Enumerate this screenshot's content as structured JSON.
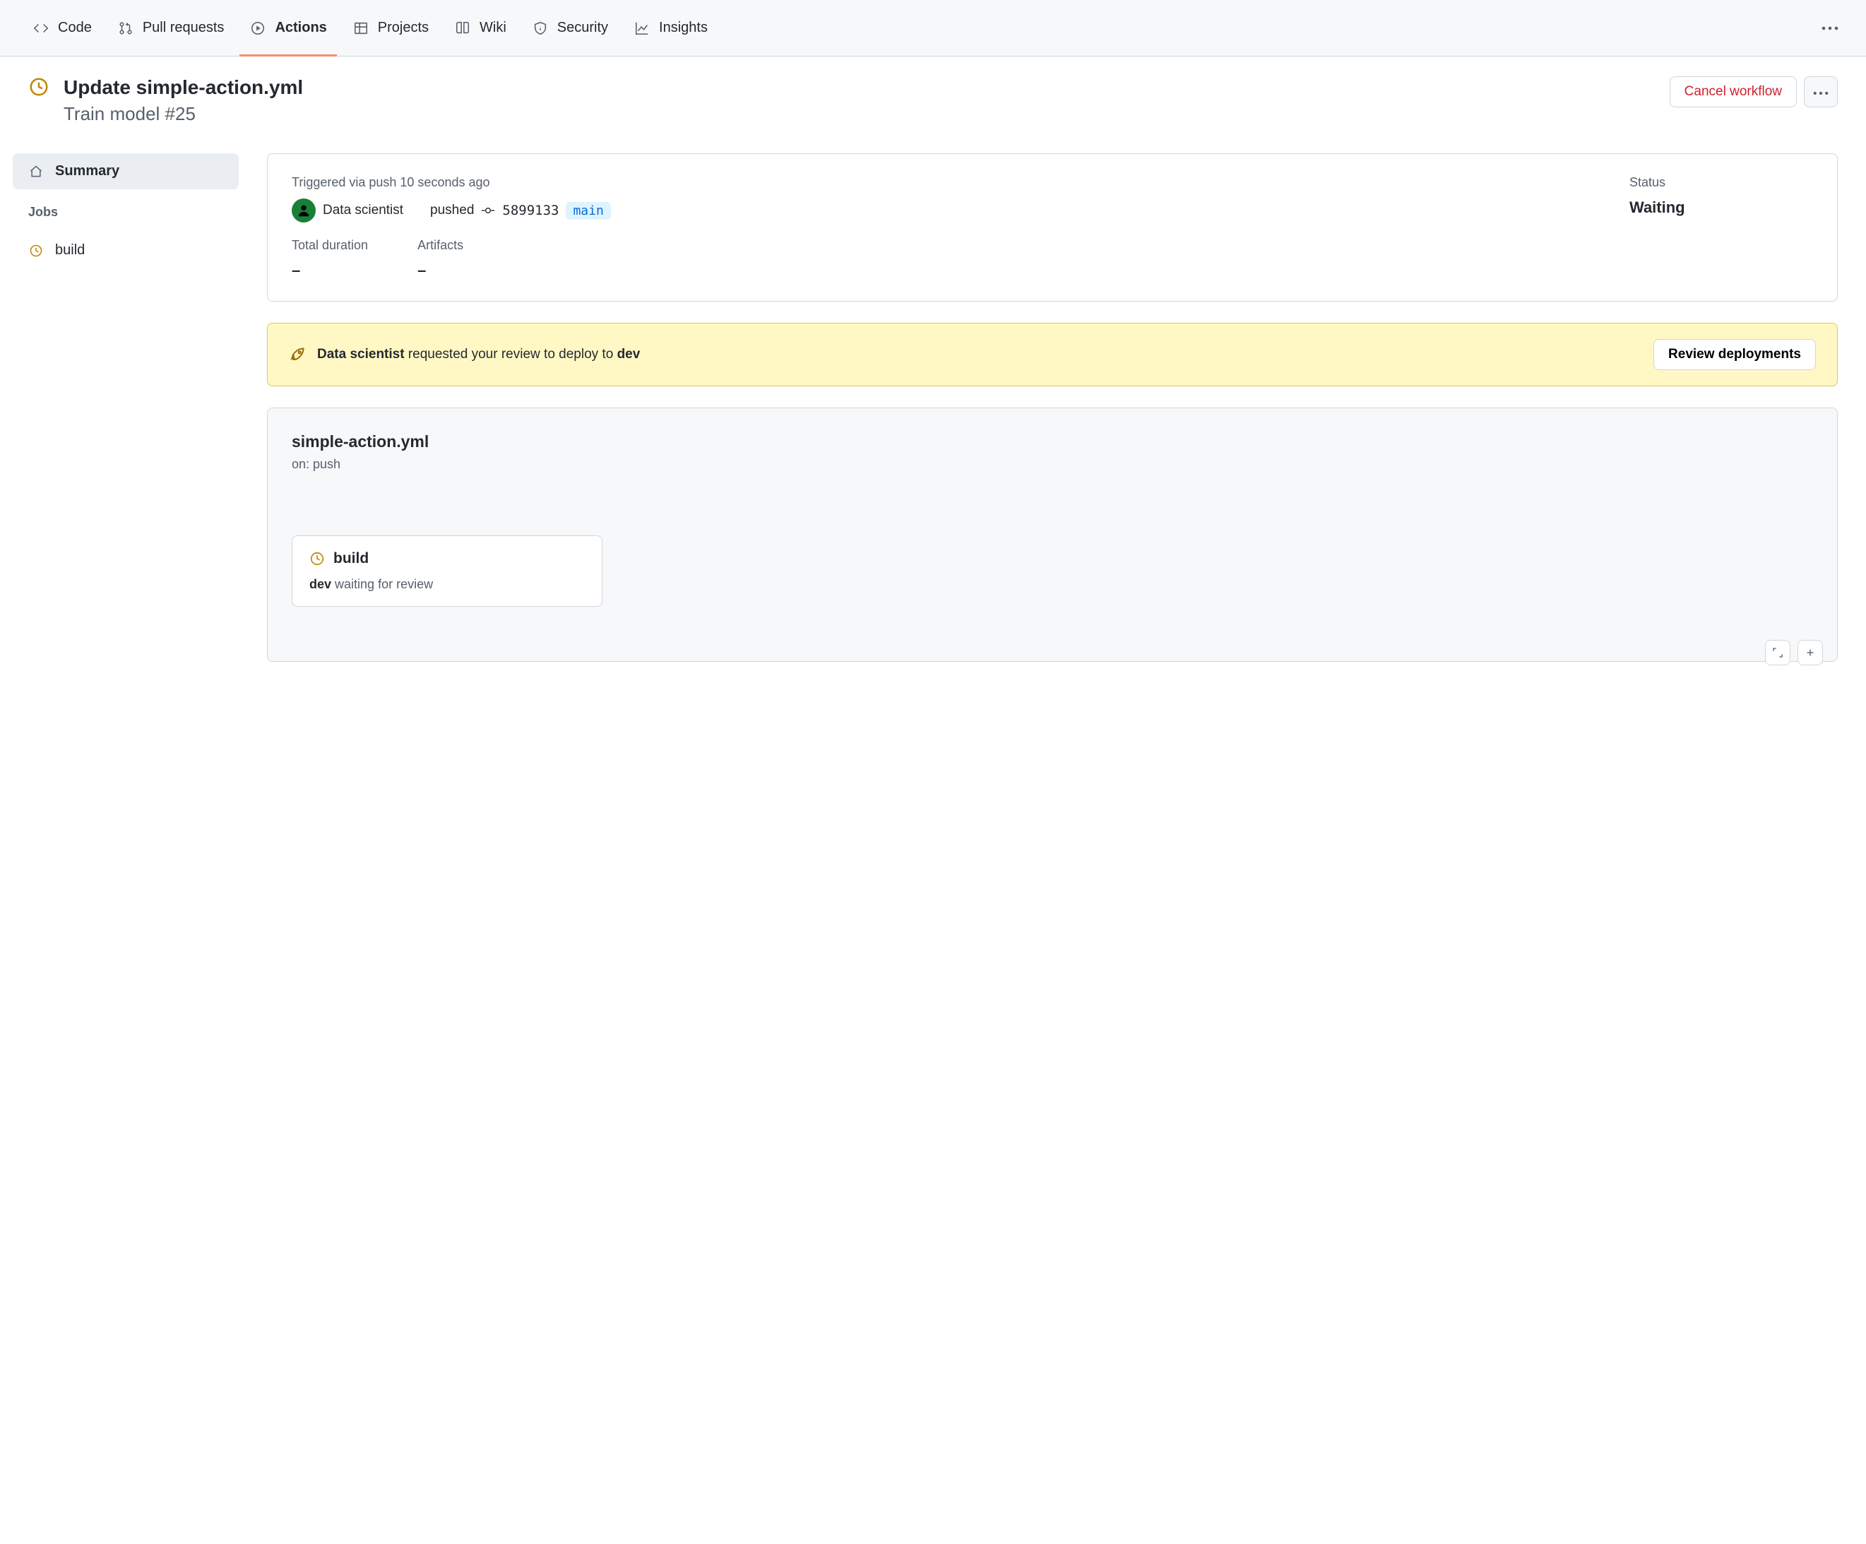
{
  "nav": {
    "code": "Code",
    "pulls": "Pull requests",
    "actions": "Actions",
    "projects": "Projects",
    "wiki": "Wiki",
    "security": "Security",
    "insights": "Insights"
  },
  "header": {
    "title": "Update simple-action.yml",
    "subtitle": "Train model #25",
    "cancel": "Cancel workflow"
  },
  "sidebar": {
    "summary": "Summary",
    "jobs_heading": "Jobs",
    "build": "build"
  },
  "summary": {
    "triggered_line": "Triggered via push 10 seconds ago",
    "user": "Data scientist",
    "pushed": "pushed",
    "sha": "5899133",
    "branch": "main",
    "status_label": "Status",
    "status_value": "Waiting",
    "duration_label": "Total duration",
    "duration_value": "–",
    "artifacts_label": "Artifacts",
    "artifacts_value": "–"
  },
  "banner": {
    "actor": "Data scientist",
    "text_middle": " requested your review to deploy to ",
    "env": "dev",
    "button": "Review deployments"
  },
  "workflow": {
    "file": "simple-action.yml",
    "on": "on: push",
    "job_name": "build",
    "job_env": "dev",
    "job_status": " waiting for review"
  }
}
